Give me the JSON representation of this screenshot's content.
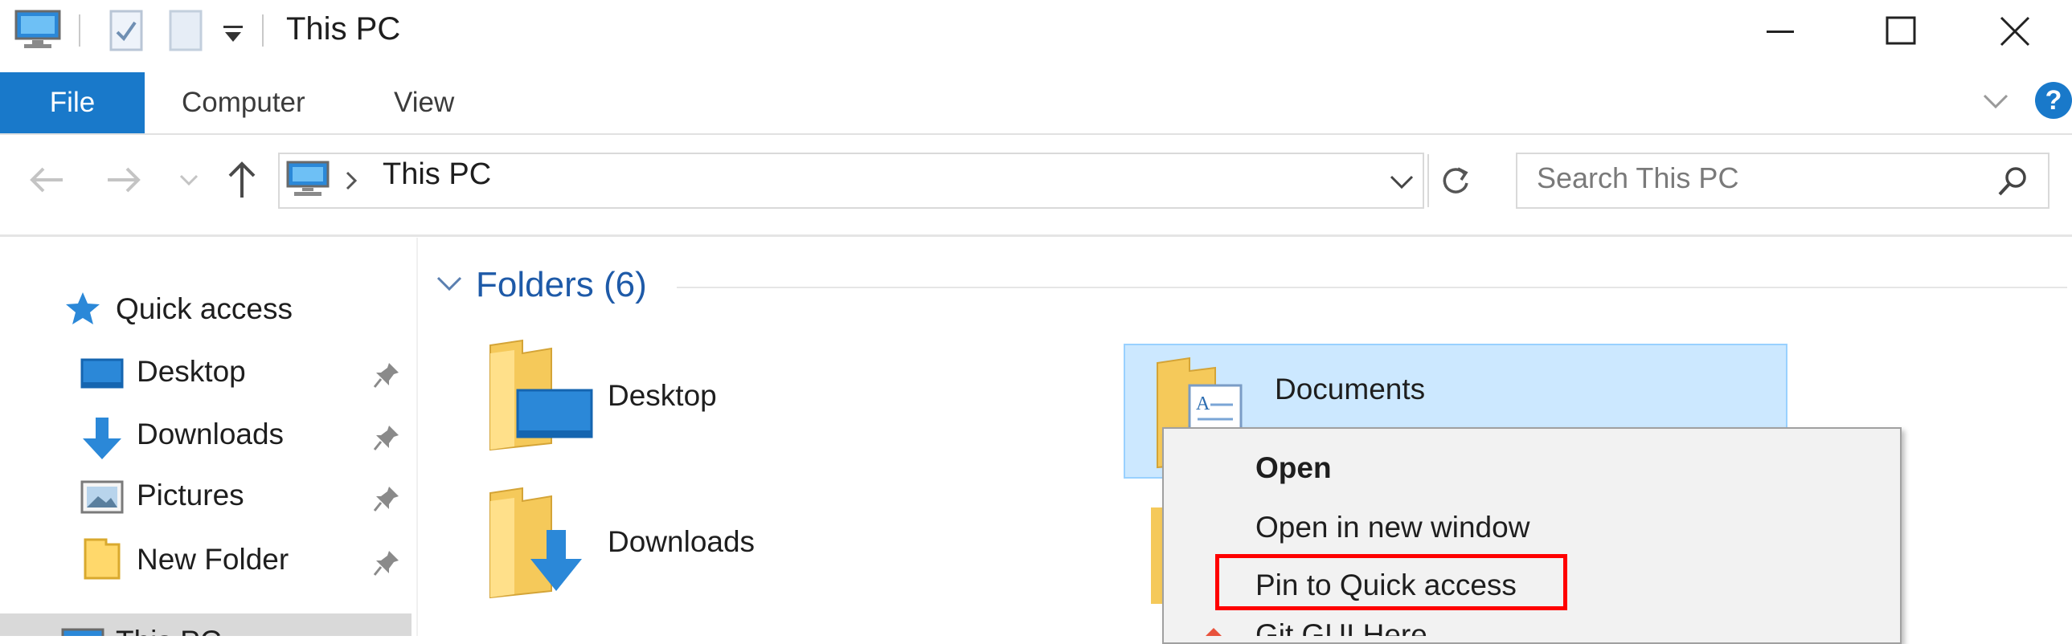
{
  "window": {
    "title": "This PC",
    "controls": {
      "minimize": "minimize-icon",
      "maximize": "maximize-icon",
      "close": "close-icon"
    }
  },
  "ribbon": {
    "tabs": [
      {
        "label": "File",
        "active": true
      },
      {
        "label": "Computer"
      },
      {
        "label": "View"
      }
    ],
    "help": "?"
  },
  "nav": {
    "address": {
      "location": "This PC"
    },
    "search": {
      "placeholder": "Search This PC"
    }
  },
  "sidebar": {
    "items": [
      {
        "label": "Quick access",
        "icon": "star-icon"
      },
      {
        "label": "Desktop",
        "icon": "desktop-icon",
        "pinned": true
      },
      {
        "label": "Downloads",
        "icon": "download-icon",
        "pinned": true
      },
      {
        "label": "Pictures",
        "icon": "pictures-icon",
        "pinned": true
      },
      {
        "label": "New Folder",
        "icon": "folder-icon",
        "pinned": true
      },
      {
        "label": "This PC",
        "icon": "computer-icon",
        "selected": true
      }
    ]
  },
  "content": {
    "group": {
      "title": "Folders (6)"
    },
    "folders": [
      {
        "name": "Desktop"
      },
      {
        "name": "Documents",
        "selected": true
      },
      {
        "name": "Downloads"
      }
    ]
  },
  "context_menu": {
    "items": [
      {
        "label": "Open",
        "bold": true
      },
      {
        "label": "Open in new window"
      },
      {
        "label": "Pin to Quick access",
        "highlighted": true
      },
      {
        "label": "Git GUI Here"
      }
    ]
  },
  "colors": {
    "accent": "#1979ca",
    "selection": "#cce8ff",
    "highlight_box": "#ff0000",
    "group_header": "#1e5aa8"
  }
}
